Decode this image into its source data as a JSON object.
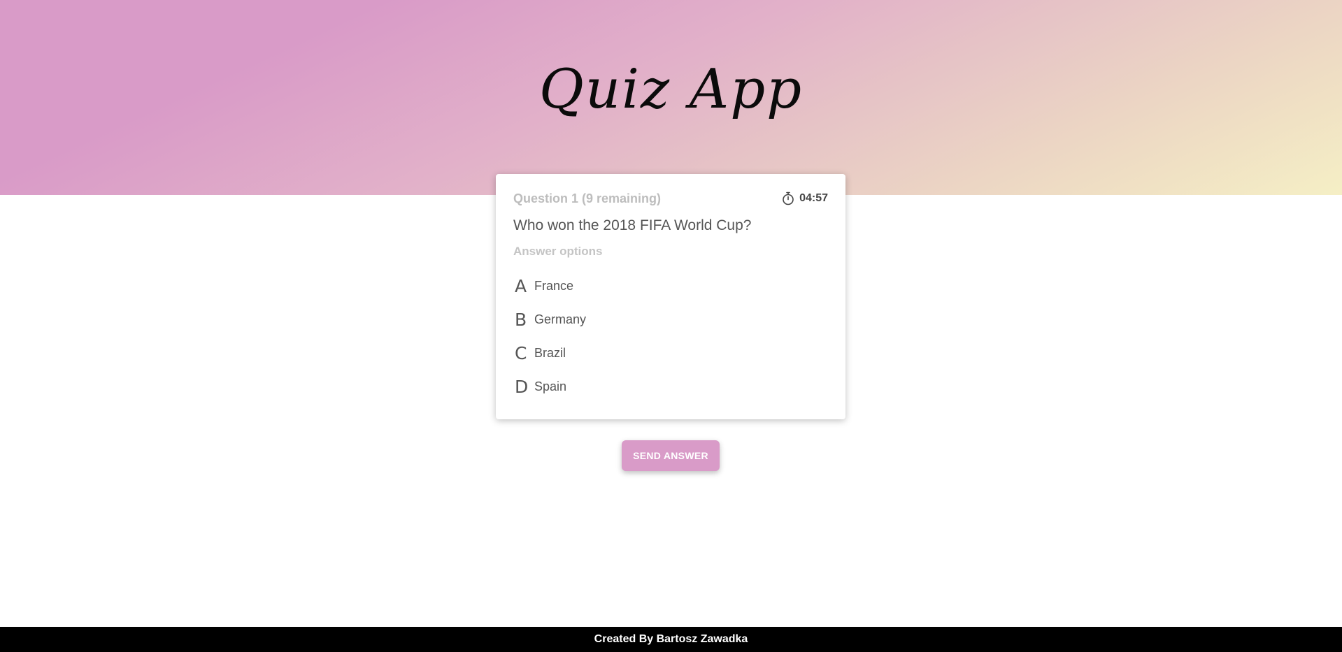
{
  "app": {
    "title": "Quiz App"
  },
  "colors": {
    "accent": "#d99bc8",
    "gradient_start": "#d99bc8",
    "gradient_end": "#f5efc5",
    "footer_bg": "#000000"
  },
  "quiz": {
    "counter": "Question 1 (9 remaining)",
    "timer": "04:57",
    "timer_icon": "stopwatch-icon",
    "question": "Who won the 2018 FIFA World Cup?",
    "answer_heading": "Answer options",
    "options": [
      {
        "letter": "A",
        "label": "France"
      },
      {
        "letter": "B",
        "label": "Germany"
      },
      {
        "letter": "C",
        "label": "Brazil"
      },
      {
        "letter": "D",
        "label": "Spain"
      }
    ],
    "send_label": "SEND ANSWER"
  },
  "footer": {
    "text": "Created By Bartosz Zawadka"
  }
}
